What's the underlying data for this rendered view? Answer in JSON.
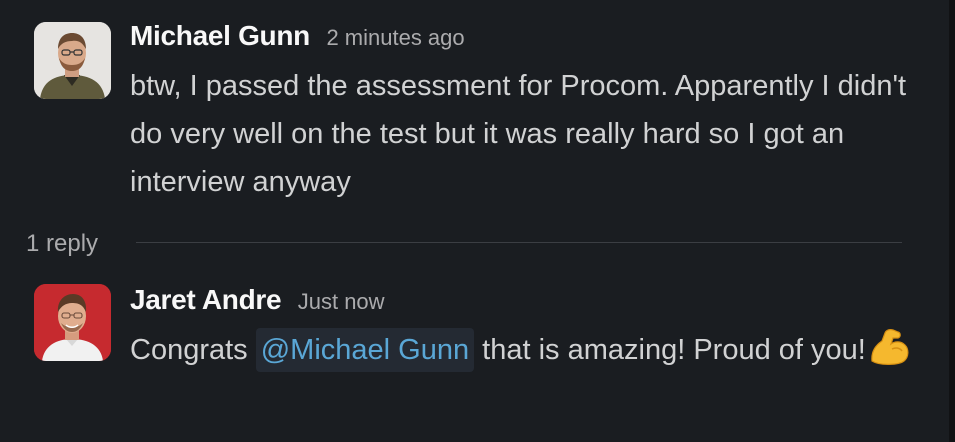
{
  "messages": [
    {
      "author": "Michael Gunn",
      "timestamp": "2 minutes ago",
      "avatar_icon": "user-avatar-photo",
      "body": "btw, I passed the assessment for Procom. Apparently I didn't do very well on the test but it was really hard so I got an interview anyway"
    },
    {
      "author": "Jaret Andre",
      "timestamp": "Just now",
      "avatar_icon": "user-avatar-photo",
      "body_before": "Congrats",
      "mention": "@Michael Gunn",
      "body_after": "that is amazing! Proud of you!",
      "emoji_icon": "flexed-biceps-icon"
    }
  ],
  "thread": {
    "reply_count": "1 reply"
  },
  "colors": {
    "background": "#1a1d21",
    "author": "#f8f8f8",
    "body": "#d1d2d3",
    "timestamp": "#ababad",
    "mention": "#5aa7d6",
    "mention_background": "#242a33"
  }
}
